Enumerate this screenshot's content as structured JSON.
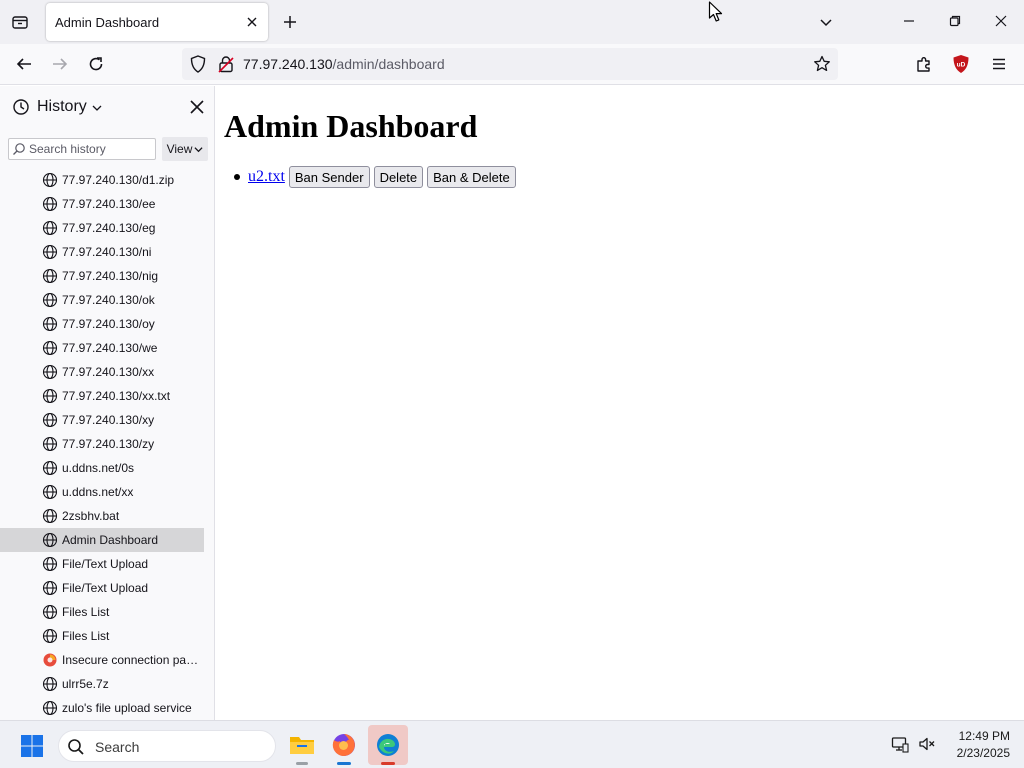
{
  "tabstrip": {
    "tab_title": "Admin Dashboard"
  },
  "navbar": {
    "url_host": "77.97.240.130",
    "url_path": "/admin/dashboard"
  },
  "sidebar": {
    "title": "History",
    "search_placeholder": "Search history",
    "view_label": "View",
    "items": [
      {
        "label": "77.97.240.130/d1.zip",
        "icon": "globe-icon"
      },
      {
        "label": "77.97.240.130/ee",
        "icon": "globe-icon"
      },
      {
        "label": "77.97.240.130/eg",
        "icon": "globe-icon"
      },
      {
        "label": "77.97.240.130/ni",
        "icon": "globe-icon"
      },
      {
        "label": "77.97.240.130/nig",
        "icon": "globe-icon"
      },
      {
        "label": "77.97.240.130/ok",
        "icon": "globe-icon"
      },
      {
        "label": "77.97.240.130/oy",
        "icon": "globe-icon"
      },
      {
        "label": "77.97.240.130/we",
        "icon": "globe-icon"
      },
      {
        "label": "77.97.240.130/xx",
        "icon": "globe-icon"
      },
      {
        "label": "77.97.240.130/xx.txt",
        "icon": "globe-icon"
      },
      {
        "label": "77.97.240.130/xy",
        "icon": "globe-icon"
      },
      {
        "label": "77.97.240.130/zy",
        "icon": "globe-icon"
      },
      {
        "label": "u.ddns.net/0s",
        "icon": "globe-icon"
      },
      {
        "label": "u.ddns.net/xx",
        "icon": "globe-icon"
      },
      {
        "label": "2zsbhv.bat",
        "icon": "globe-icon"
      },
      {
        "label": "Admin Dashboard",
        "icon": "globe-icon",
        "selected": true
      },
      {
        "label": "File/Text Upload",
        "icon": "globe-icon"
      },
      {
        "label": "File/Text Upload",
        "icon": "globe-icon"
      },
      {
        "label": "Files List",
        "icon": "globe-icon"
      },
      {
        "label": "Files List",
        "icon": "globe-icon"
      },
      {
        "label": "Insecure connection pass...",
        "icon": "warning-icon"
      },
      {
        "label": "ulrr5e.7z",
        "icon": "globe-icon"
      },
      {
        "label": "zulo's file upload service",
        "icon": "globe-icon"
      }
    ]
  },
  "content": {
    "title": "Admin Dashboard",
    "messages": [
      {
        "file_link": "u2.txt",
        "ban_label": "Ban Sender",
        "delete_label": "Delete",
        "ban_delete_label": "Ban & Delete"
      }
    ]
  },
  "taskbar": {
    "search_label": "Search",
    "time": "12:49 PM",
    "date": "2/23/2025"
  },
  "colors": {
    "link": "#0000ee",
    "selected_row": "#d6d6d8",
    "ublock_red": "#c4161c"
  }
}
